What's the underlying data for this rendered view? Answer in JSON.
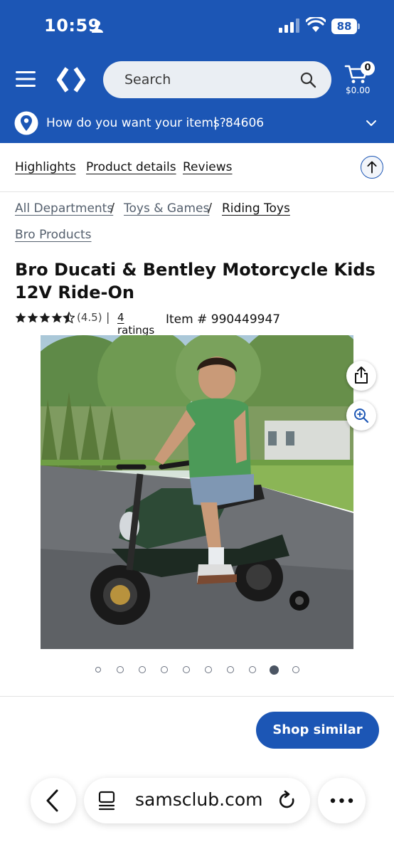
{
  "status_bar": {
    "time": "10:59",
    "battery": "88"
  },
  "header": {
    "search_placeholder": "Search",
    "cart_count": "0",
    "cart_total": "$0.00",
    "location_prompt": "How do you want your items?",
    "separator": "|",
    "zip": "84606"
  },
  "tabs": [
    "Highlights",
    "Product details",
    "Reviews"
  ],
  "breadcrumb": {
    "items": [
      "All Departments",
      "Toys & Games",
      "Riding Toys"
    ],
    "separator": "/",
    "brand": "Bro Products"
  },
  "product": {
    "title": "Bro Ducati & Bentley Motorcycle Kids 12V Ride-On",
    "rating_value": "(4.5)",
    "rating_stars": 4.5,
    "rating_separator": "|",
    "ratings_link": "4 ratings",
    "item_number": "Item # 990449947"
  },
  "carousel": {
    "count": 10,
    "active_index": 8
  },
  "actions": {
    "shop_similar": "Shop similar"
  },
  "browser": {
    "url": "samsclub.com"
  },
  "colors": {
    "brand_blue": "#1c56b5"
  }
}
